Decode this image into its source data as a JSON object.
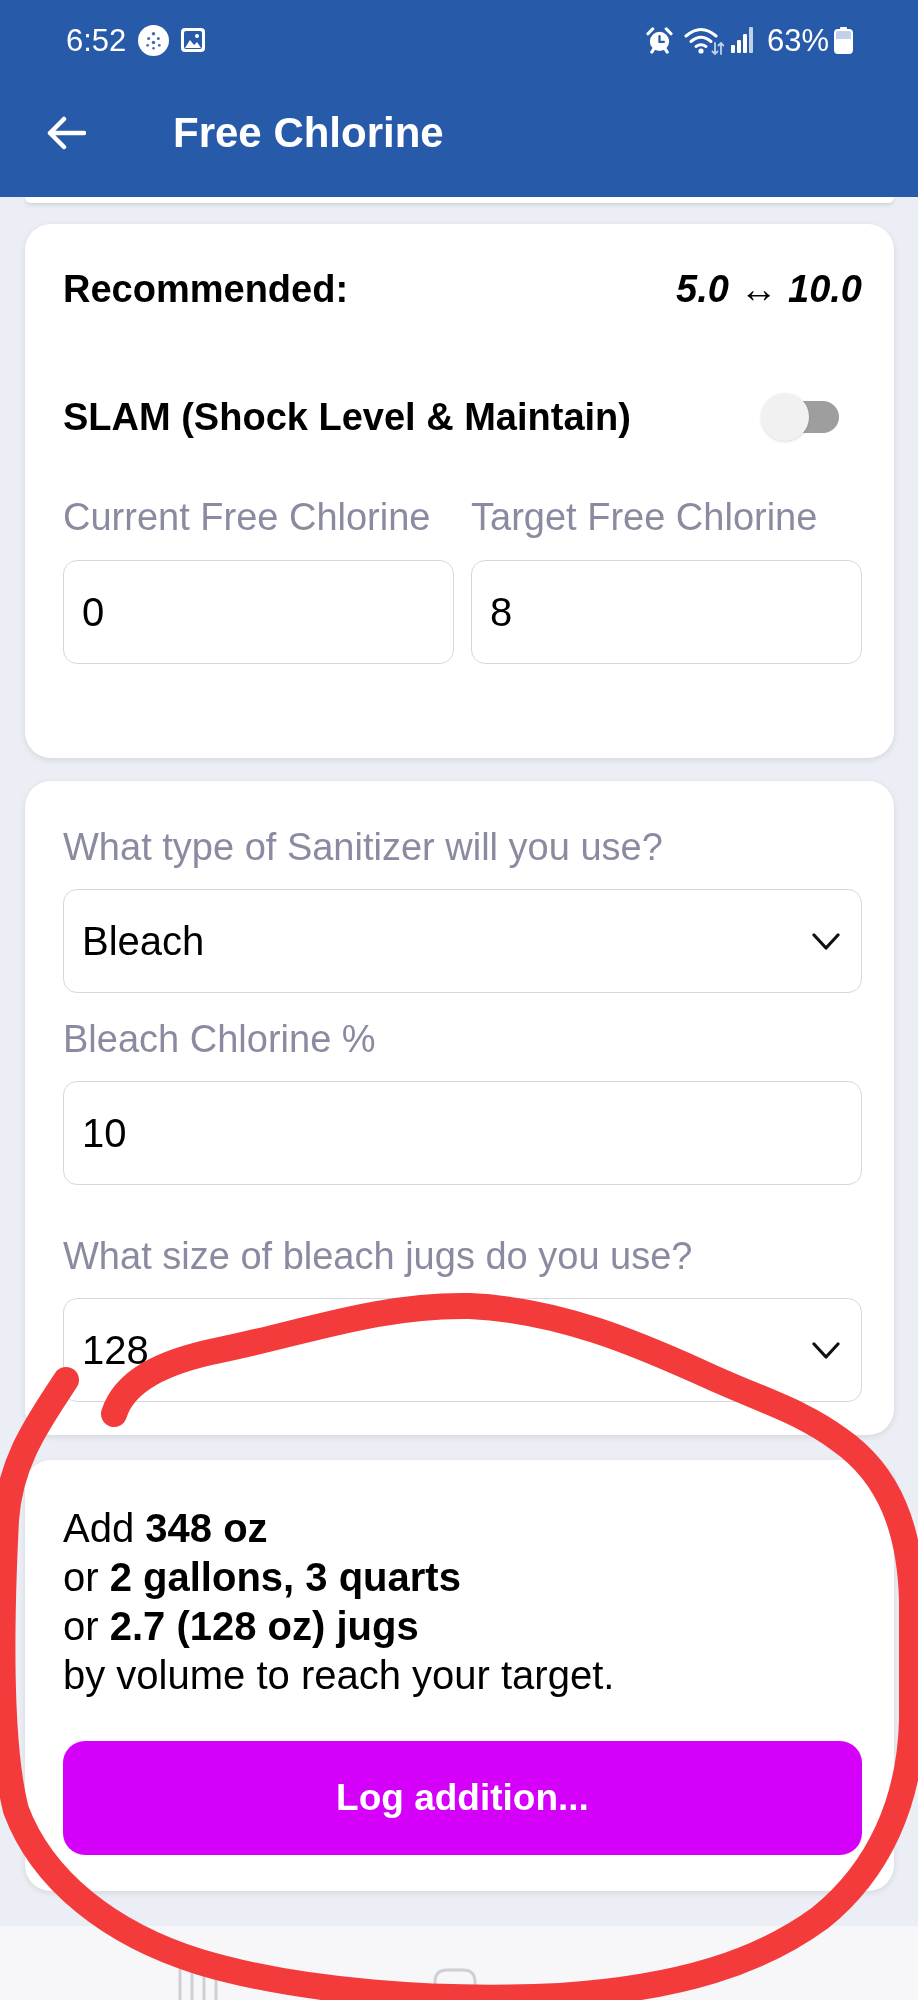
{
  "status_bar": {
    "time": "6:52",
    "battery": "63%"
  },
  "header": {
    "title": "Free Chlorine"
  },
  "levels_card": {
    "recommended": {
      "label": "Recommended:",
      "range": "5.0 ↔ 10.0"
    },
    "slam": {
      "label": "SLAM (Shock Level & Maintain)",
      "on": false
    },
    "fields": [
      {
        "label": "Current Free Chlorine",
        "value": "0"
      },
      {
        "label": "Target Free Chlorine",
        "value": "8"
      }
    ]
  },
  "sanitizer_card": {
    "fields": [
      {
        "kind": "select",
        "label": "What type of Sanitizer will you use?",
        "value": "Bleach"
      },
      {
        "kind": "input",
        "label": "Bleach Chlorine %",
        "value": "10"
      },
      {
        "kind": "select",
        "label": "What size of bleach jugs do you use?",
        "value": "128"
      }
    ]
  },
  "result_card": {
    "lines": [
      "Add **348 oz**",
      "or **2 gallons, 3 quarts**",
      "or **2.7 (128 oz) jugs**",
      "by volume to reach your target."
    ],
    "button": "Log addition..."
  }
}
